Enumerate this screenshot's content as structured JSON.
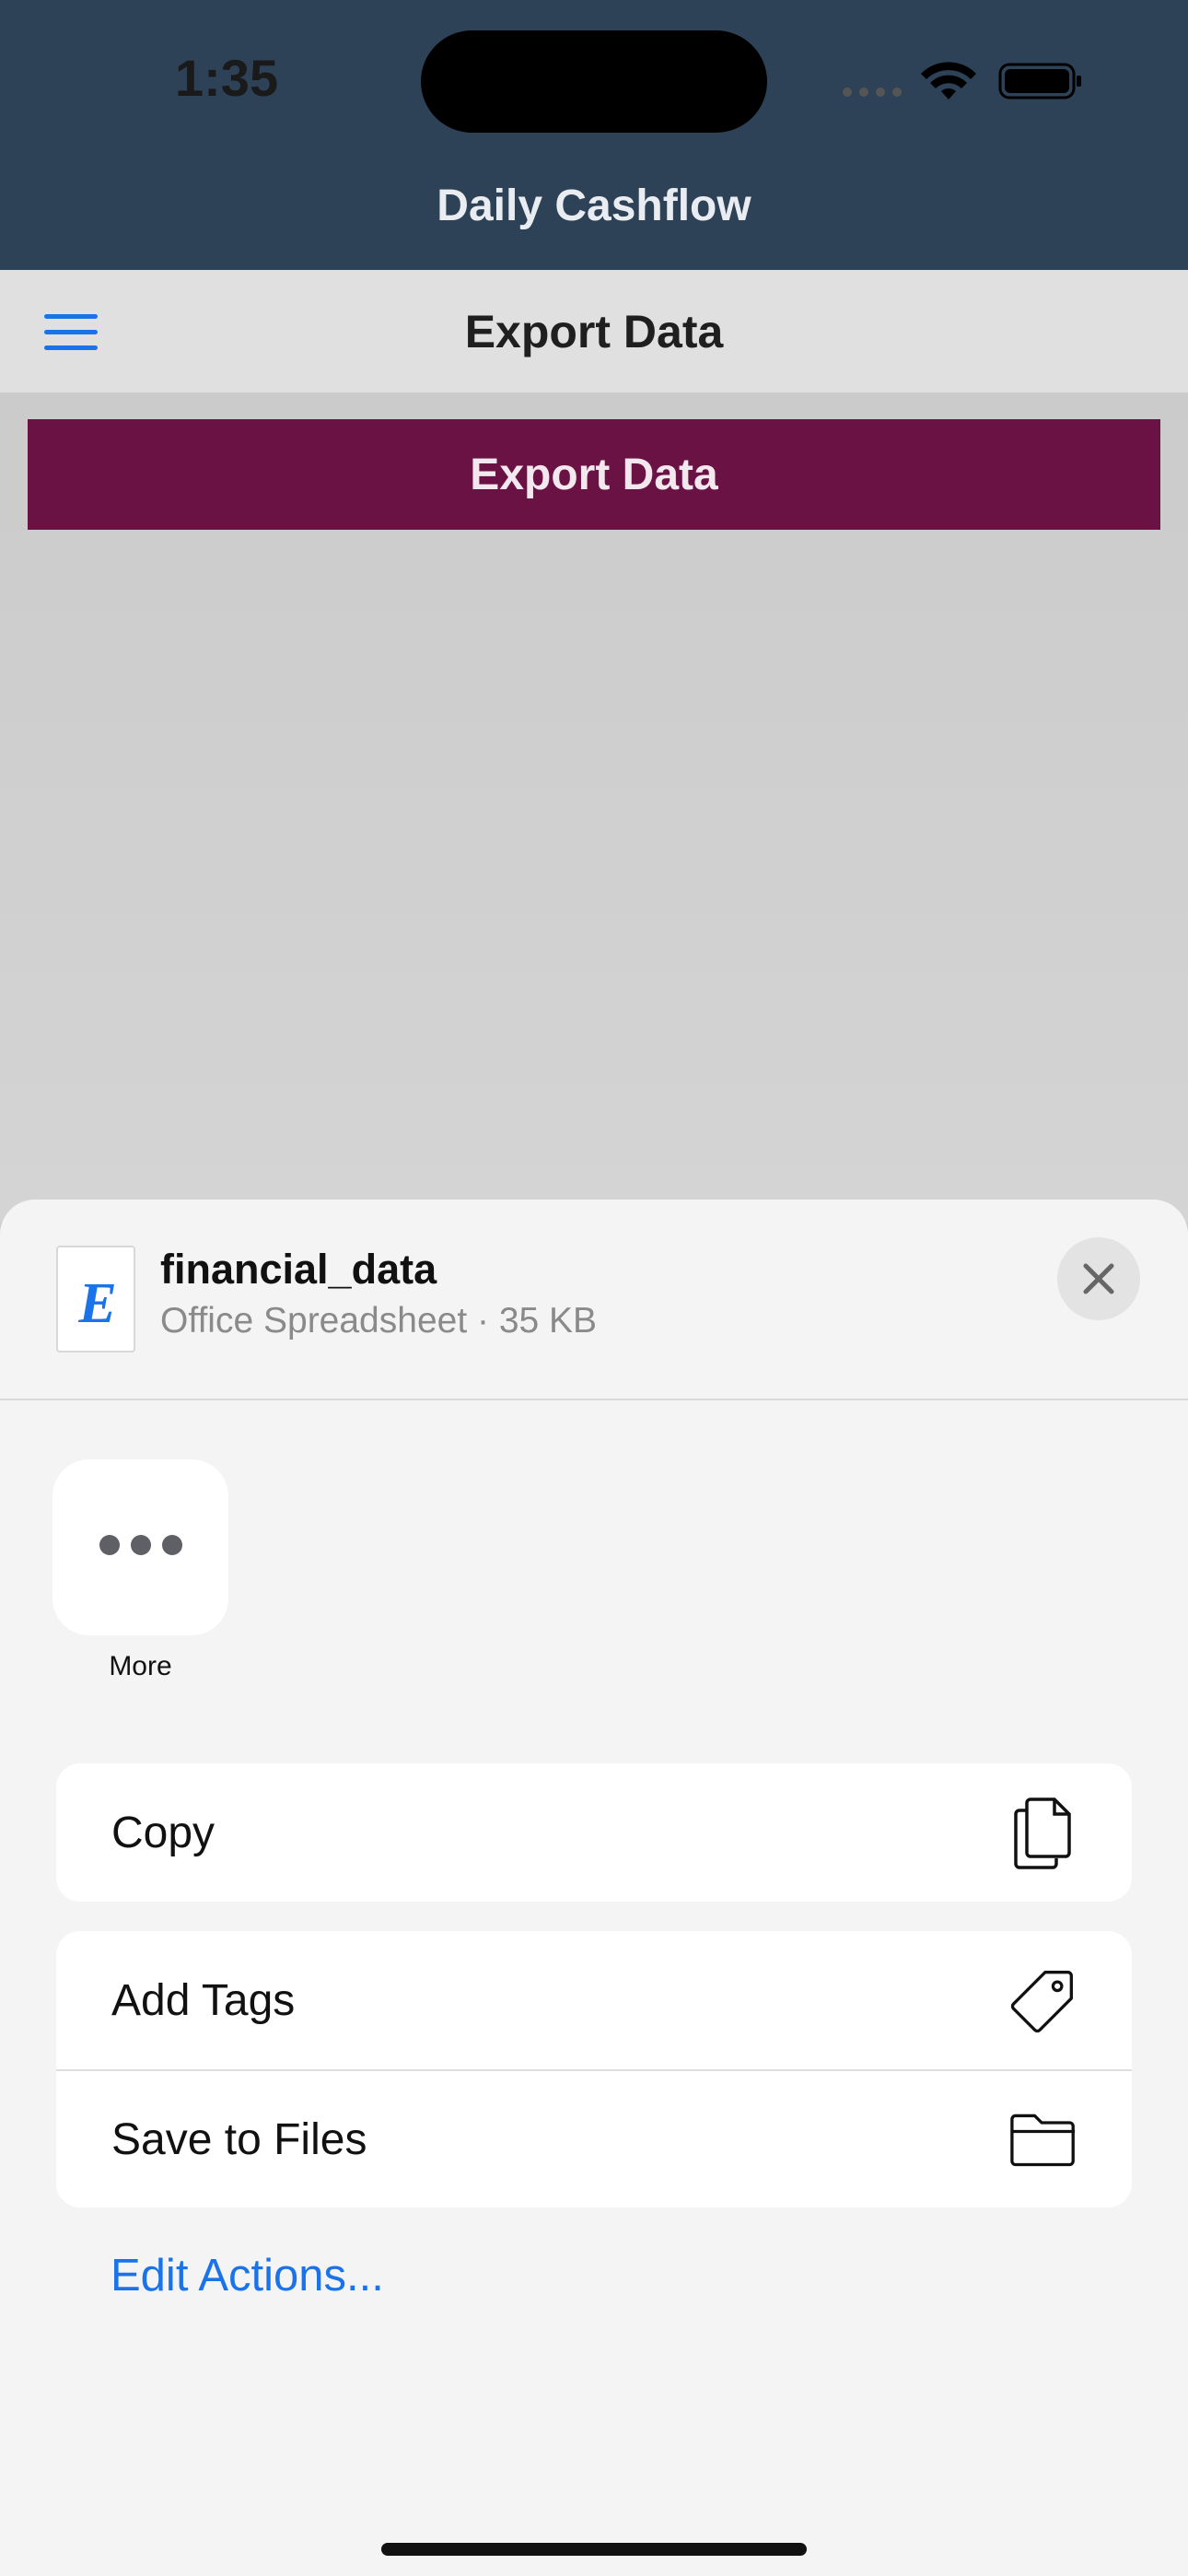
{
  "status_bar": {
    "time": "1:35"
  },
  "app": {
    "title": "Daily Cashflow"
  },
  "navbar": {
    "title": "Export Data"
  },
  "main": {
    "export_button_label": "Export Data"
  },
  "share_sheet": {
    "file_icon_letter": "E",
    "file_name": "financial_data",
    "file_meta": "Office Spreadsheet · 35 KB",
    "more_label": "More",
    "actions_group1": [
      {
        "label": "Copy",
        "icon": "copy-icon"
      }
    ],
    "actions_group2": [
      {
        "label": "Add Tags",
        "icon": "tag-icon"
      },
      {
        "label": "Save to Files",
        "icon": "folder-icon"
      }
    ],
    "edit_actions_label": "Edit Actions..."
  },
  "colors": {
    "header_bg": "#2d4157",
    "export_button": "#6b1245",
    "accent": "#1a73e8"
  }
}
